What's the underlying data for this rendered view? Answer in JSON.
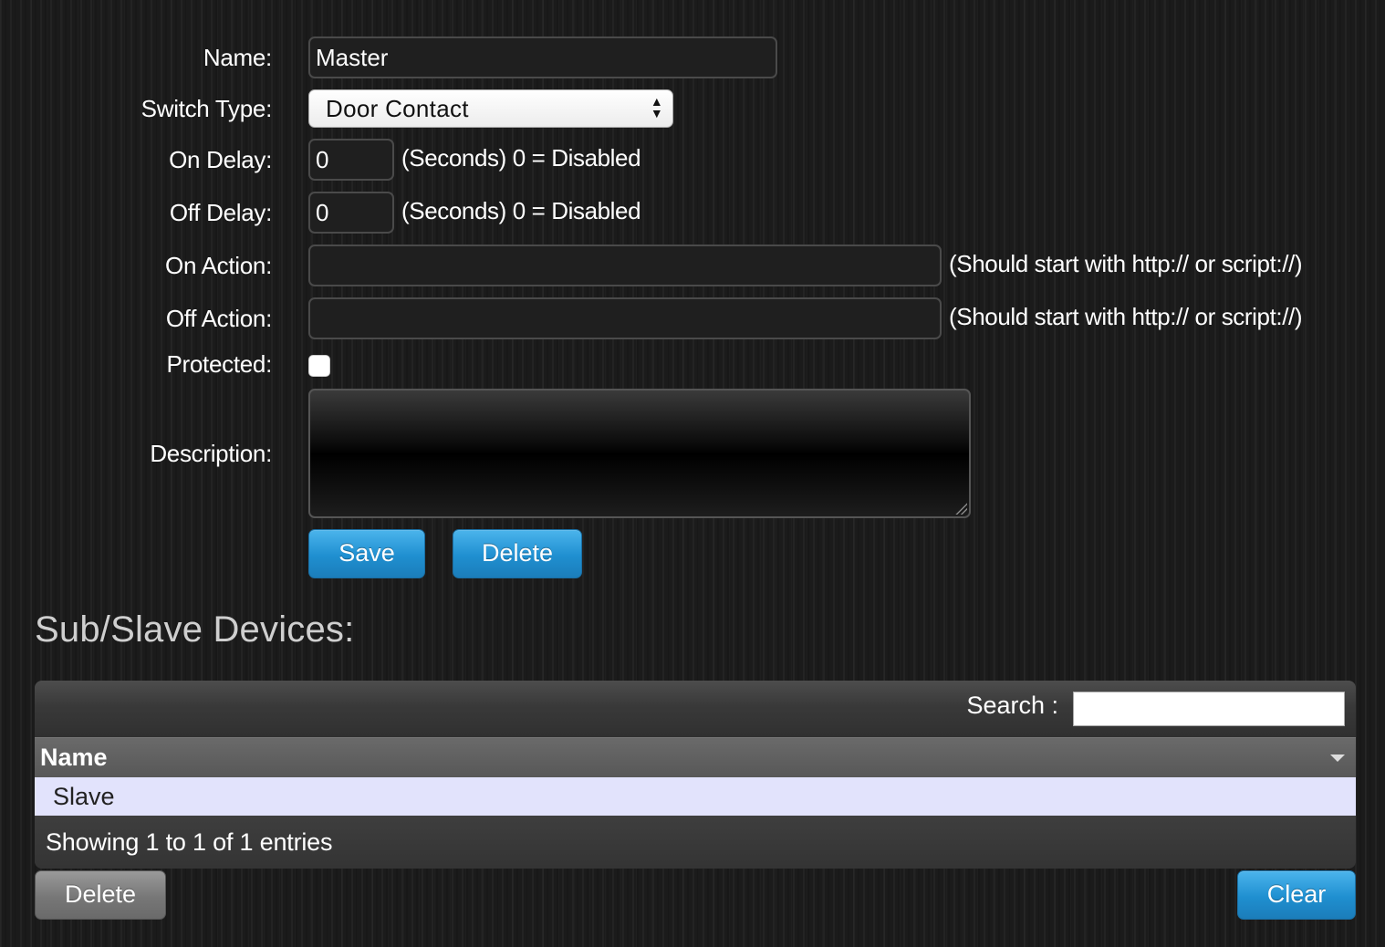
{
  "form": {
    "name_label": "Name:",
    "name_value": "Master",
    "switch_type_label": "Switch Type:",
    "switch_type_value": "Door Contact",
    "on_delay_label": "On Delay:",
    "on_delay_value": "0",
    "on_delay_hint": "(Seconds) 0 = Disabled",
    "off_delay_label": "Off Delay:",
    "off_delay_value": "0",
    "off_delay_hint": "(Seconds) 0 = Disabled",
    "on_action_label": "On Action:",
    "on_action_value": "",
    "on_action_hint": "(Should start with http:// or script://)",
    "off_action_label": "Off Action:",
    "off_action_value": "",
    "off_action_hint": "(Should start with http:// or script://)",
    "protected_label": "Protected:",
    "protected_checked": false,
    "description_label": "Description:",
    "description_value": "",
    "save_label": "Save",
    "delete_label": "Delete"
  },
  "subdevices": {
    "title": "Sub/Slave Devices:",
    "search_label": "Search :",
    "search_value": "",
    "column_name": "Name",
    "rows": [
      {
        "name": "Slave"
      }
    ],
    "footer_text": "Showing 1 to 1 of 1 entries",
    "delete_label": "Delete",
    "clear_label": "Clear"
  },
  "colors": {
    "accent_blue": "#2a9ad9",
    "selected_row": "#e2e3fc",
    "background": "#1b1b1b"
  }
}
